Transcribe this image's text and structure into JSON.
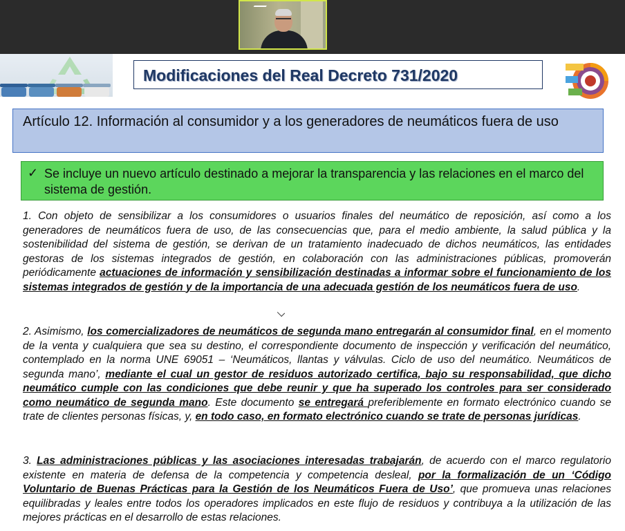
{
  "colors": {
    "topbar": "#2b2b2b",
    "title_text": "#1f3864",
    "article_bg": "#b4c6e7",
    "green_bg": "#5cd65c",
    "video_border": "#d2e64a"
  },
  "slide": {
    "title": "Modificaciones del Real Decreto 731/2020",
    "article_heading": "Artículo 12. Información al consumidor y a los generadores de neumáticos fuera de uso",
    "check_symbol": "✓",
    "summary": "Se incluye un nuevo artículo destinado a mejorar la transparencia y las relaciones en el marco del sistema de gestión."
  },
  "paragraphs": [
    {
      "segments": [
        {
          "text": "1. Con objeto de sensibilizar a los consumidores o usuarios finales del neumático de reposición, así como a los generadores de neumáticos fuera de uso, de las consecuencias que, para el medio ambiente, la salud pública y la sostenibilidad del sistema de gestión, se derivan de un tratamiento inadecuado de dichos neumáticos, las entidades gestoras de los sistemas integrados de gestión, en colaboración con las administraciones públicas, promoverán periódicamente ",
          "bold": false
        },
        {
          "text": "actuaciones de información y sensibilización destinadas a informar sobre el funcionamiento de los sistemas integrados de gestión y de la importancia de una adecuada gestión de los neumáticos fuera de uso",
          "bold": true
        },
        {
          "text": ".",
          "bold": false
        }
      ]
    },
    {
      "segments": [
        {
          "text": "2. Asimismo, ",
          "bold": false
        },
        {
          "text": "los comercializadores de neumáticos de segunda mano entregarán al consumidor final",
          "bold": true
        },
        {
          "text": ", en el momento de la venta y cualquiera que sea su destino, el correspondiente documento de inspección y verificación del neumático, contemplado en la norma UNE 69051 – ‘Neumáticos, llantas y válvulas. Ciclo de uso del neumático. Neumáticos de segunda mano’, ",
          "bold": false
        },
        {
          "text": "mediante el cual un gestor de residuos autorizado certifica, bajo su responsabilidad, que dicho neumático cumple con las condiciones que debe reunir y que ha superado los controles para ser considerado como neumático de segunda mano",
          "bold": true
        },
        {
          "text": ". Este documento ",
          "bold": false
        },
        {
          "text": "se entregará ",
          "bold": true
        },
        {
          "text": "preferiblemente en formato electrónico cuando se trate de clientes personas físicas, y, ",
          "bold": false
        },
        {
          "text": "en todo caso, en formato electrónico cuando se trate de personas jurídicas",
          "bold": true
        },
        {
          "text": ".",
          "bold": false
        }
      ]
    },
    {
      "segments": [
        {
          "text": "3. ",
          "bold": false
        },
        {
          "text": "Las administraciones públicas y las asociaciones interesadas trabajarán",
          "bold": true
        },
        {
          "text": ", de acuerdo con el marco regulatorio existente en materia de defensa de la competencia y competencia desleal, ",
          "bold": false
        },
        {
          "text": "por la formalización de un ‘Código Voluntario de Buenas Prácticas para la Gestión de los Neumáticos Fuera de Uso’",
          "bold": true
        },
        {
          "text": ", que promueva unas relaciones equilibradas y leales entre todos los operadores implicados en este flujo de residuos y contribuya a la utilización de las mejores prácticas en el desarrollo de estas relaciones.",
          "bold": false
        }
      ]
    }
  ],
  "icons": {
    "webcam": "participant-video-thumbnail",
    "left_banner": "recycling-bins-image",
    "right_logo": "circular-economy-logo"
  }
}
